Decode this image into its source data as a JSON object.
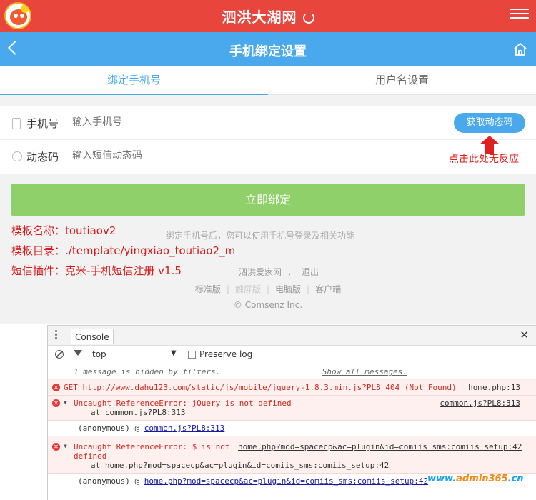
{
  "topbar": {
    "title": "泗洪大湖网"
  },
  "subbar": {
    "title": "手机绑定设置"
  },
  "tabs": [
    {
      "label": "绑定手机号"
    },
    {
      "label": "用户名设置"
    }
  ],
  "form": {
    "phone_label": "手机号",
    "phone_placeholder": "输入手机号",
    "code_label": "动态码",
    "code_placeholder": "输入短信动态码",
    "get_code_button": "获取动态码"
  },
  "annotation": {
    "note": "点击此处无反应"
  },
  "bind_button": "立即绑定",
  "hint": "绑定手机号后，您可以使用手机号登录及相关功能",
  "info": {
    "template_name": "模板名称：toutiaov2",
    "template_dir": "模板目录：./template/yingxiao_toutiao2_m",
    "sms_plugin": "短信插件：克米-手机短信注册 v1.5"
  },
  "footer": {
    "site": "泗洪爱家网",
    "logout": "退出",
    "links": [
      "标准版",
      "触屏版",
      "电脑版",
      "客户端"
    ],
    "copyright": "© Comsenz Inc."
  },
  "console": {
    "tab": "Console",
    "context": "top",
    "preserve_log": "Preserve log",
    "hidden_msg": "1 message is hidden by filters.",
    "show_all": "Show all messages.",
    "errors": [
      {
        "text": "GET http://www.dahu123.com/static/js/mobile/jquery-1.8.3.min.js?PL8 404 (Not Found)",
        "source": "home.php:13"
      },
      {
        "text": "Uncaught ReferenceError: jQuery is not defined",
        "at": "at common.js?PL8:313",
        "anon": "(anonymous) @ ",
        "anon_link": "common.js?PL8:313",
        "source": "common.js?PL8:313"
      },
      {
        "text": "Uncaught ReferenceError: $ is not",
        "text2": "defined",
        "at": "at home.php?mod=spacecp&ac=plugin&id=comiis_sms:comiis_setup:42",
        "anon": "(anonymous) @ ",
        "anon_link": "home.php?mod=spacecp&ac=plugin&id=comiis_sms:comiis_setup:42",
        "source": "home.php?mod=spacecp&ac=plugin&id=comiis_sms:comiis_setup:42"
      }
    ]
  },
  "watermark": {
    "pre": "www.",
    "brand": "admin365",
    "post": ".cn"
  },
  "colors": {
    "top_red": "#e8453c",
    "blue": "#49a9ec",
    "green": "#8fd06a",
    "error_red": "#d12b1e"
  }
}
